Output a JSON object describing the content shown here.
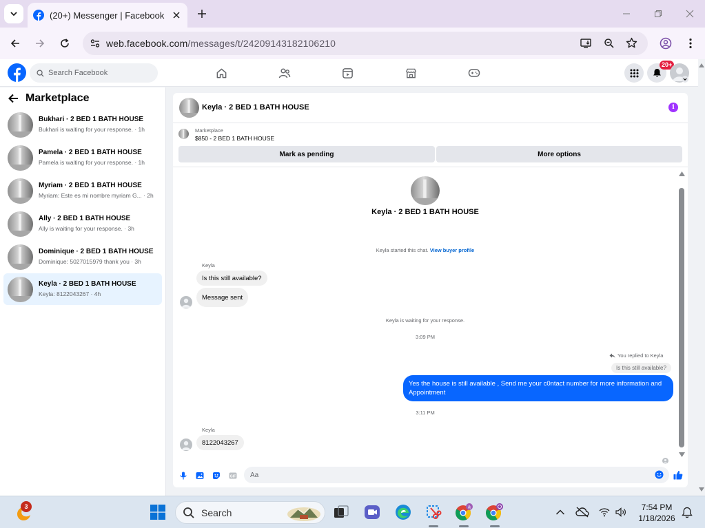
{
  "browser": {
    "tab_title": "(20+) Messenger | Facebook",
    "url_host": "web.facebook.com",
    "url_path": "/messages/t/24209143182106210"
  },
  "fb_header": {
    "search_placeholder": "Search Facebook",
    "notification_count": "20+"
  },
  "sidebar": {
    "title": "Marketplace",
    "conversations": [
      {
        "name": "Bukhari · 2 BED 1 BATH HOUSE",
        "snippet": "Bukhari is waiting for your response. · 1h",
        "active": false
      },
      {
        "name": "Pamela · 2 BED 1 BATH HOUSE",
        "snippet": "Pamela is waiting for your response. · 1h",
        "active": false
      },
      {
        "name": "Myriam · 2 BED 1 BATH HOUSE",
        "snippet": "Myriam: Este es mi nombre myriam G... · 2h",
        "active": false
      },
      {
        "name": "Ally · 2 BED 1 BATH HOUSE",
        "snippet": "Ally is waiting for your response. · 3h",
        "active": false
      },
      {
        "name": "Dominique · 2 BED 1 BATH HOUSE",
        "snippet": "Dominique: 5027015979 thank you · 3h",
        "active": false
      },
      {
        "name": "Keyla · 2 BED 1 BATH HOUSE",
        "snippet": "Keyla: 8122043267 · 4h",
        "active": true
      }
    ]
  },
  "chat": {
    "header_title": "Keyla · 2 BED 1 BATH HOUSE",
    "marketplace_label": "Marketplace",
    "listing": "$850 - 2 BED 1 BATH HOUSE",
    "mark_pending_label": "Mark as pending",
    "more_options_label": "More options",
    "profile_title": "Keyla · 2 BED 1 BATH HOUSE",
    "started_text": "Keyla started this chat.",
    "view_profile_link": "View buyer profile",
    "sender_name": "Keyla",
    "msg1": "Is this still available?",
    "msg2": "Message sent",
    "waiting_text": "Keyla is waiting for your response.",
    "time1": "3:09 PM",
    "replied_label": "You replied to Keyla",
    "quoted_text": "Is this still available?",
    "reply_text": "Yes the house is still available , Send me your c0ntact number for more information and Appointment",
    "time2": "3:11 PM",
    "sender_name2": "Keyla",
    "msg3": "8122043267",
    "composer_placeholder": "Aa"
  },
  "taskbar": {
    "search_label": "Search",
    "widget_badge": "3",
    "time": "7:54 PM",
    "date": "1/18/2026"
  }
}
